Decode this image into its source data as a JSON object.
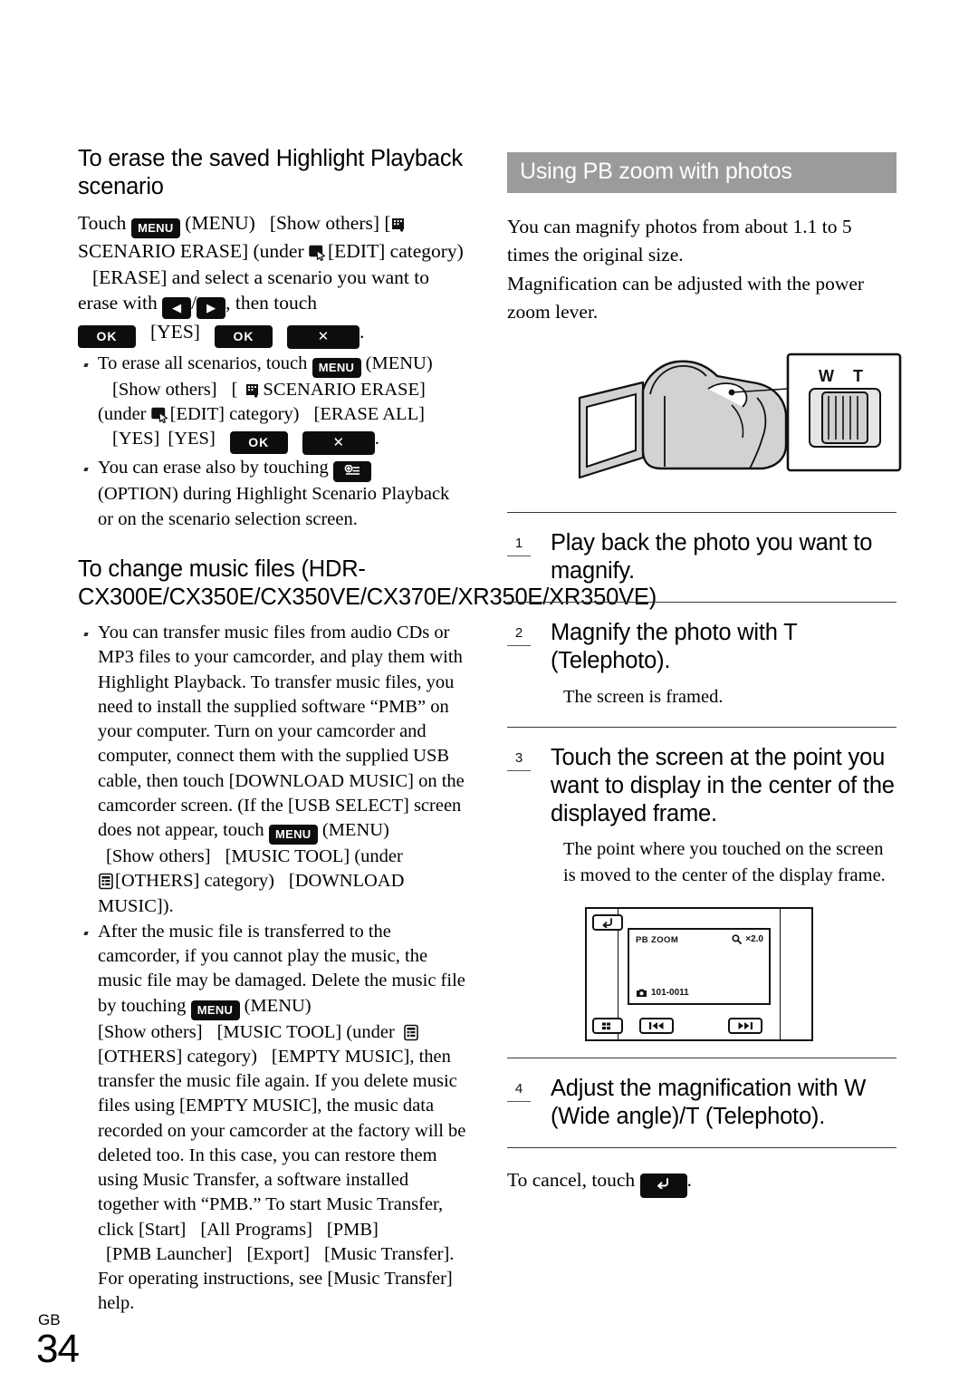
{
  "page": {
    "locale_code": "GB",
    "number": "34"
  },
  "left_column": {
    "section1": {
      "heading": "To erase the saved Highlight Playback scenario",
      "paragraph": {
        "t1": "Touch",
        "menu_key": "MENU",
        "t2": "(MENU)",
        "t3": "[Show others]",
        "t4": "[",
        "t5": "SCENARIO ERASE] (under",
        "t6": "[EDIT]",
        "t7": "category)",
        "t8": "[ERASE] and select a scenario",
        "t9": "you want to erase with",
        "arrow_left": "◀",
        "slash": "/",
        "arrow_right": "▶",
        "t10": ", then touch",
        "ok1": "OK",
        "yes1": "[YES]",
        "ok2": "OK",
        "close1": "✕",
        "period": "."
      },
      "bullets": [
        {
          "t1": "To erase all scenarios, touch",
          "menu_key": "MENU",
          "t2": "(MENU)",
          "t3": "[Show others]",
          "t4": "[",
          "t5": "SCENARIO ERASE]",
          "t6": "(under",
          "t7": "[EDIT] category)",
          "t8": "[ERASE ALL]",
          "t9": "[YES]",
          "t10": "[YES]",
          "ok": "OK",
          "close": "✕",
          "period": "."
        },
        {
          "t1": "You can erase also by touching",
          "option_key": "OPTION",
          "t2": "(OPTION) during Highlight Scenario Playback or on the scenario selection screen."
        }
      ]
    },
    "section2": {
      "heading": "To change music files (HDR-CX300E/CX350E/CX350VE/CX370E/XR350E/XR350VE)",
      "bullets": [
        {
          "t1": "You can transfer music files from audio CDs or MP3 files to your camcorder, and play them with Highlight Playback. To transfer music files, you need to install the supplied software “PMB” on your computer. Turn on your camcorder and computer, connect them with the supplied USB cable, then touch [DOWNLOAD MUSIC] on the camcorder screen. (If the [USB SELECT] screen does not appear, touch",
          "menu_key": "MENU",
          "t2": "(MENU)",
          "t3": "[Show others]",
          "t4": "[MUSIC TOOL] (under",
          "t5": "[OTHERS] category)",
          "t6": "[DOWNLOAD MUSIC])."
        },
        {
          "t1": "After the music file is transferred to the camcorder, if you cannot play the music, the music file may be damaged. Delete the music file by touching",
          "menu_key": "MENU",
          "t2": "(MENU)",
          "t3": "[Show others]",
          "t4": "[MUSIC TOOL] (under",
          "t5": "[OTHERS] category)",
          "t6": "[EMPTY MUSIC], then transfer the music file again. If you delete music files using [EMPTY MUSIC], the music data recorded on your camcorder at the factory will be deleted too. In this case, you can restore them using Music Transfer, a software installed together with “PMB.” To start Music Transfer, click [Start]",
          "t7": "[All Programs]",
          "t8": "[PMB]",
          "t9": "[PMB Launcher]",
          "t10": "[Export]",
          "t11": "[Music Transfer]. For operating instructions, see [Music Transfer] help."
        }
      ]
    }
  },
  "right_column": {
    "bar_heading": "Using PB zoom with photos",
    "intro": [
      "You can magnify photos from about 1.1 to 5 times the original size.",
      "Magnification can be adjusted with the power zoom lever."
    ],
    "camcorder_figure": {
      "zoom_lever_wide": "W",
      "zoom_lever_tele": "T"
    },
    "steps": [
      {
        "number": "1",
        "title": "Play back the photo you want to magnify.",
        "note": ""
      },
      {
        "number": "2",
        "title": "Magnify the photo with T (Telephoto).",
        "note": "The screen is framed."
      },
      {
        "number": "3",
        "title": "Touch the screen at the point you want to display in the center of the displayed frame.",
        "note": "The point where you touched on the screen is moved to the center of the display frame."
      },
      {
        "number": "4",
        "title": "Adjust the magnification with W (Wide angle)/T (Telephoto).",
        "note": ""
      }
    ],
    "pb_zoom_screen": {
      "label": "PB ZOOM",
      "magnification": "×2.0",
      "file_number": "101-0011",
      "back_icon": "back-arrow-icon",
      "index_icon": "index-grid-icon",
      "prev_icon": "previous-icon",
      "next_icon": "next-icon"
    },
    "cancel_note": {
      "t1": "To cancel, touch",
      "back_key": "back",
      "period": "."
    }
  },
  "colors": {
    "bar_background": "#9b9b9b",
    "bar_text": "#ffffff",
    "key_background": "#0d0d0d",
    "key_text": "#ffffff",
    "body_text": "#000000",
    "illustration_fill": "#cfcfcf"
  }
}
